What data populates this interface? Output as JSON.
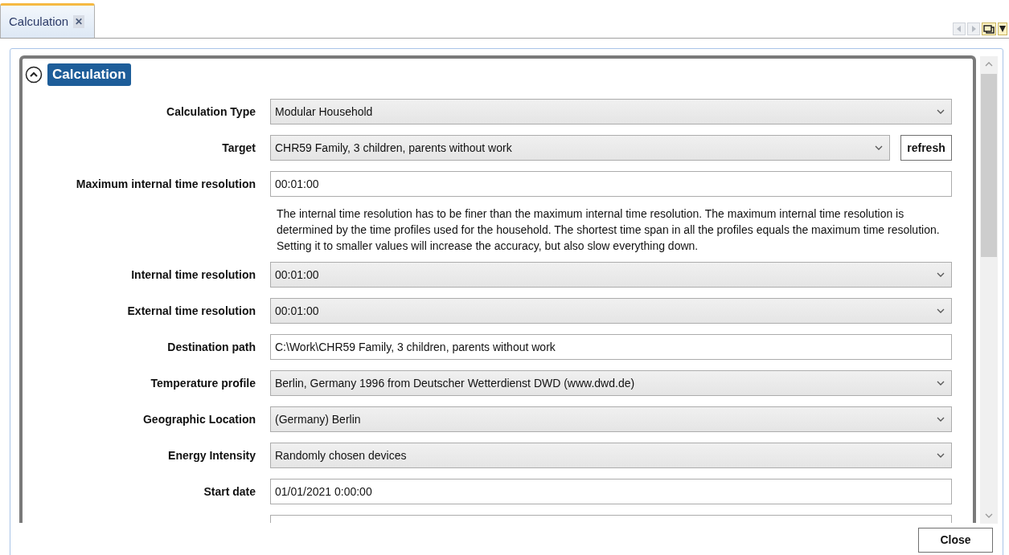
{
  "tab": {
    "label": "Calculation",
    "close": "✕",
    "selected": true
  },
  "section": {
    "title": "Calculation",
    "expanded": true
  },
  "rows": [
    {
      "label": "Calculation Type",
      "kind": "dropdown",
      "value": "Modular Household"
    },
    {
      "label": "Target",
      "kind": "dropdown",
      "value": "CHR59 Family, 3 children, parents without work",
      "button": "refresh"
    },
    {
      "label": "Maximum internal time resolution",
      "kind": "text",
      "value": "00:01:00"
    },
    {
      "kind": "note",
      "value": "The internal time resolution has to be finer than the maximum internal time resolution. The maximum internal time resolution is determined by the time profiles used for the household. The shortest time span in all the profiles equals the maximum time resolution. Setting it to smaller values will increase the accuracy, but also slow everything down."
    },
    {
      "label": "Internal time resolution",
      "kind": "dropdown",
      "value": "00:01:00"
    },
    {
      "label": "External time resolution",
      "kind": "dropdown",
      "value": "00:01:00"
    },
    {
      "label": "Destination path",
      "kind": "text",
      "value": "C:\\Work\\CHR59 Family, 3 children, parents without work"
    },
    {
      "label": "Temperature profile",
      "kind": "dropdown",
      "value": "Berlin, Germany 1996 from Deutscher Wetterdienst DWD (www.dwd.de)"
    },
    {
      "label": "Geographic Location",
      "kind": "dropdown",
      "value": "(Germany) Berlin"
    },
    {
      "label": "Energy Intensity",
      "kind": "dropdown",
      "value": "Randomly chosen devices"
    },
    {
      "label": "Start date",
      "kind": "text",
      "value": "01/01/2021 0:00:00"
    },
    {
      "kind": "cut"
    }
  ],
  "close_button": "Close"
}
